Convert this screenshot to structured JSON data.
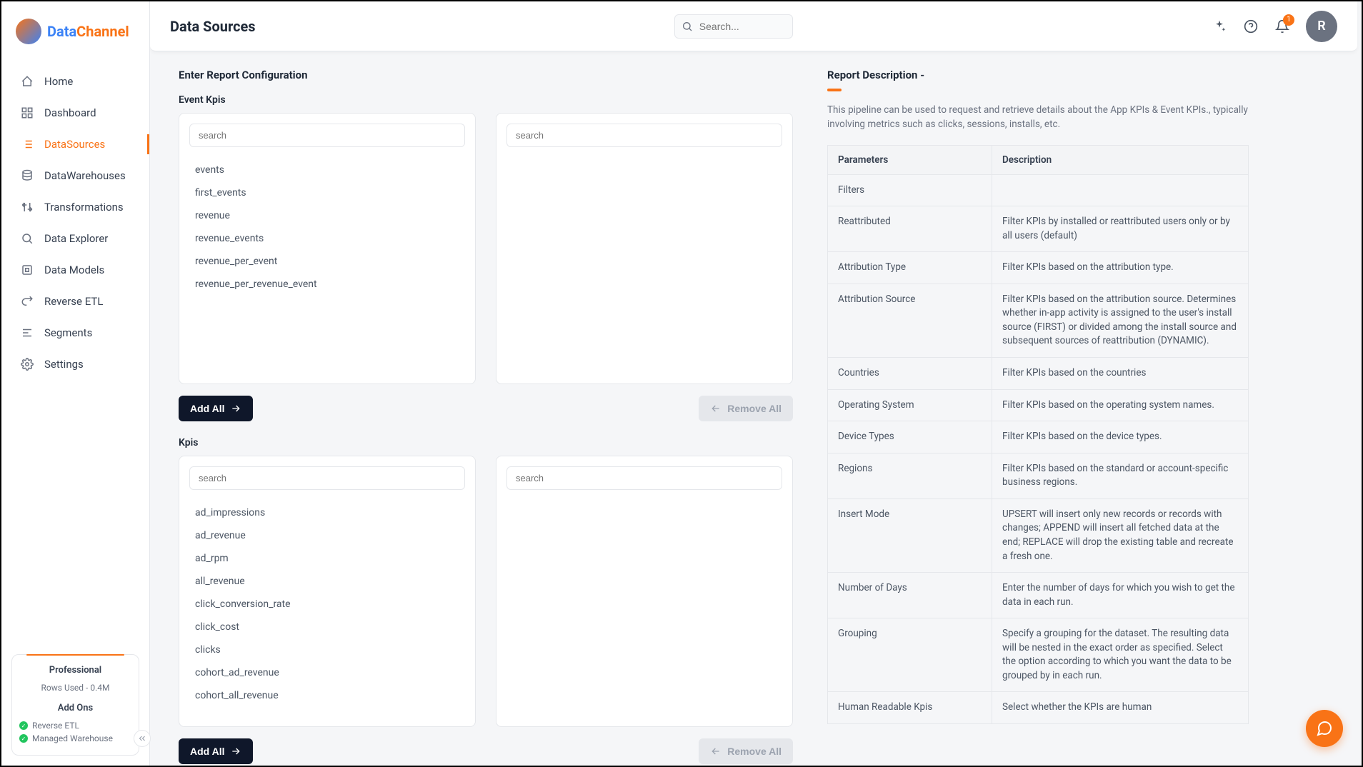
{
  "brand": {
    "a": "Data",
    "b": "Channel"
  },
  "topbar": {
    "title": "Data Sources",
    "search_placeholder": "Search...",
    "notification_count": "1",
    "avatar_initial": "R"
  },
  "nav": {
    "items": [
      {
        "label": "Home"
      },
      {
        "label": "Dashboard"
      },
      {
        "label": "DataSources"
      },
      {
        "label": "DataWarehouses"
      },
      {
        "label": "Transformations"
      },
      {
        "label": "Data Explorer"
      },
      {
        "label": "Data Models"
      },
      {
        "label": "Reverse ETL"
      },
      {
        "label": "Segments"
      },
      {
        "label": "Settings"
      }
    ]
  },
  "plan": {
    "name": "Professional",
    "rows": "Rows Used - 0.4M",
    "addons_title": "Add Ons",
    "addons": [
      {
        "label": "Reverse ETL"
      },
      {
        "label": "Managed Warehouse"
      }
    ]
  },
  "config": {
    "heading": "Enter Report Configuration",
    "event_kpis_label": "Event Kpis",
    "kpis_label": "Kpis",
    "search_placeholder": "search",
    "add_all": "Add All",
    "remove_all": "Remove All",
    "event_kpis": [
      "events",
      "first_events",
      "revenue",
      "revenue_events",
      "revenue_per_event",
      "revenue_per_revenue_event"
    ],
    "kpis": [
      "ad_impressions",
      "ad_revenue",
      "ad_rpm",
      "all_revenue",
      "click_conversion_rate",
      "click_cost",
      "clicks",
      "cohort_ad_revenue",
      "cohort_all_revenue"
    ]
  },
  "description": {
    "heading": "Report Description -",
    "text": "This pipeline can be used to request and retrieve details about the App KPIs & Event KPIs., typically involving metrics such as clicks, sessions, installs, etc.",
    "th_param": "Parameters",
    "th_desc": "Description",
    "rows": [
      {
        "p": "Filters",
        "d": ""
      },
      {
        "p": "Reattributed",
        "d": "Filter KPIs by installed or reattributed users only or by all users (default)"
      },
      {
        "p": "Attribution Type",
        "d": "Filter KPIs based on the attribution type."
      },
      {
        "p": "Attribution Source",
        "d": "Filter KPIs based on the attribution source. Determines whether in-app activity is assigned to the user's install source (FIRST) or divided among the install source and subsequent sources of reattribution (DYNAMIC)."
      },
      {
        "p": "Countries",
        "d": "Filter KPIs based on the countries"
      },
      {
        "p": "Operating System",
        "d": "Filter KPIs based on the operating system names."
      },
      {
        "p": "Device Types",
        "d": "Filter KPIs based on the device types."
      },
      {
        "p": "Regions",
        "d": "Filter KPIs based on the standard or account-specific business regions."
      },
      {
        "p": "Insert Mode",
        "d": "UPSERT will insert only new records or records with changes; APPEND will insert all fetched data at the end; REPLACE will drop the existing table and recreate a fresh one."
      },
      {
        "p": "Number of Days",
        "d": "Enter the number of days for which you wish to get the data in each run."
      },
      {
        "p": "Grouping",
        "d": "Specify a grouping for the dataset. The resulting data will be nested in the exact order as specified. Select the option according to which you want the data to be grouped by in each run."
      },
      {
        "p": "Human Readable Kpis",
        "d": "Select whether the KPIs are human"
      }
    ]
  }
}
